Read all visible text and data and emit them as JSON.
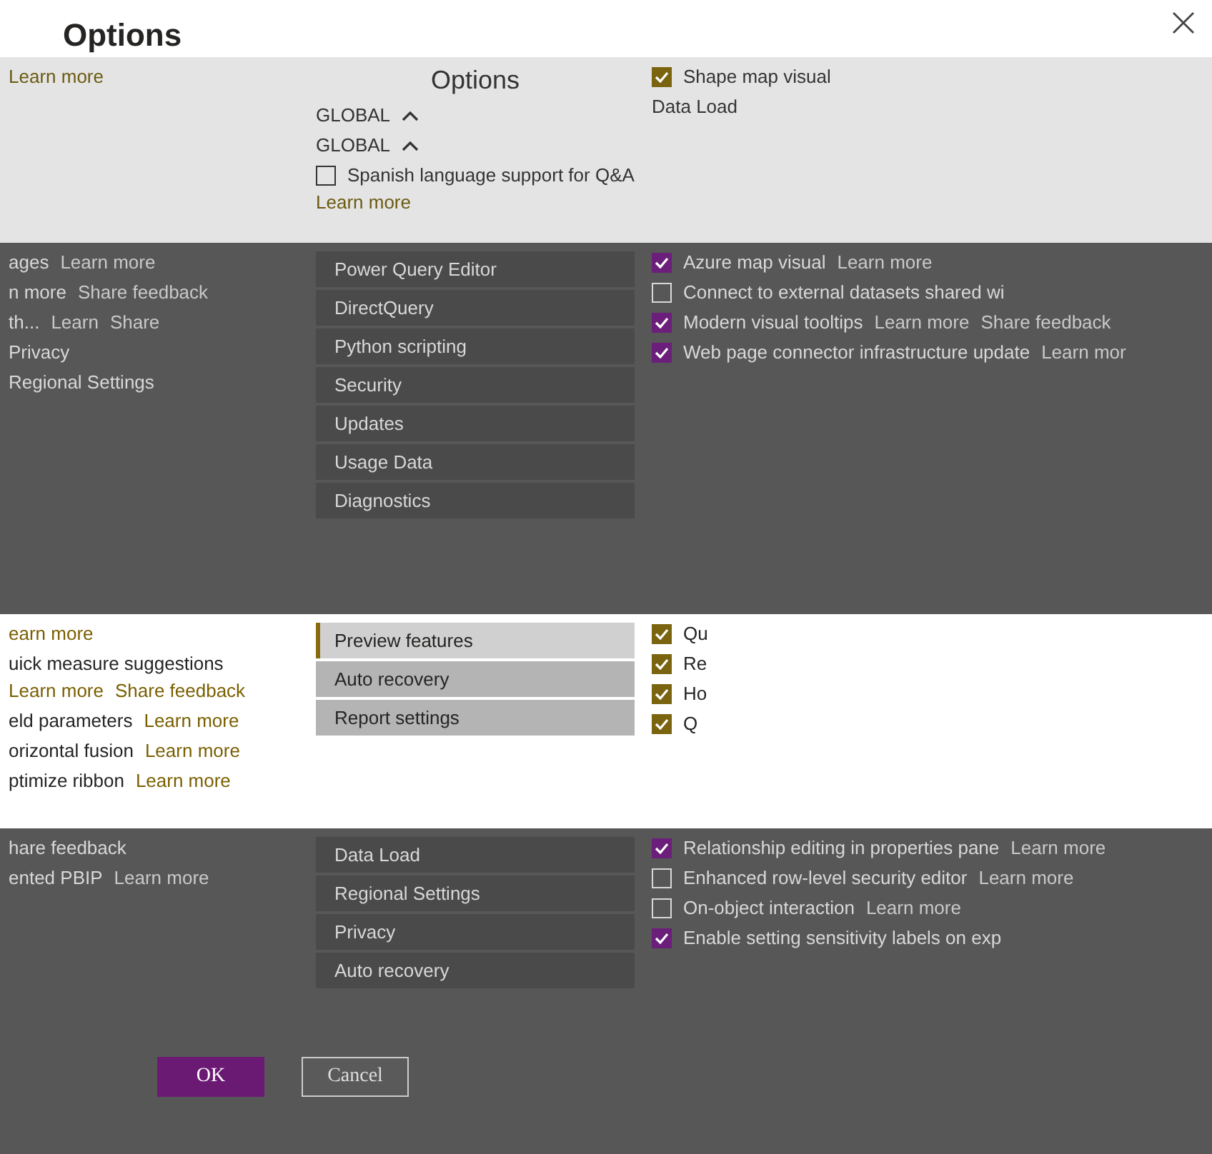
{
  "window": {
    "title": "Options"
  },
  "bands": [
    {
      "kind": "light",
      "columns": [
        [
          {
            "kind": "link",
            "text": "Learn more"
          }
        ],
        [
          {
            "kind": "heading",
            "text": "Options"
          },
          {
            "kind": "scope",
            "text": "GLOBAL"
          },
          {
            "kind": "scope",
            "text": "GLOBAL"
          },
          {
            "kind": "check",
            "label": "Spanish language support for Q&A",
            "checked": false,
            "links": [
              "Learn more"
            ]
          }
        ],
        [
          {
            "kind": "check",
            "label": "Shape map visual",
            "checked": true
          },
          {
            "kind": "line",
            "text": "Data Load"
          }
        ]
      ]
    },
    {
      "kind": "dark",
      "columns": [
        [
          {
            "kind": "line",
            "text": "ages",
            "links": [
              "Learn more"
            ]
          },
          {
            "kind": "line",
            "text": "n more",
            "links": [
              "Share feedback"
            ]
          },
          {
            "kind": "line",
            "text": "th...",
            "links": [
              "Learn",
              "Share"
            ]
          },
          {
            "kind": "line",
            "text": "Privacy"
          },
          {
            "kind": "line",
            "text": "Regional Settings"
          }
        ],
        [
          {
            "kind": "nav",
            "label": "Power Query Editor",
            "selected": false
          },
          {
            "kind": "nav",
            "label": "DirectQuery",
            "selected": false
          },
          {
            "kind": "nav",
            "label": "Python scripting",
            "selected": false
          },
          {
            "kind": "nav",
            "label": "Security",
            "selected": false
          },
          {
            "kind": "nav",
            "label": "Updates",
            "selected": false
          },
          {
            "kind": "nav",
            "label": "Usage Data",
            "selected": false
          },
          {
            "kind": "nav",
            "label": "Diagnostics",
            "selected": false
          }
        ],
        [
          {
            "kind": "check",
            "label": "Azure map visual",
            "checked": true,
            "links": [
              "Learn more"
            ]
          },
          {
            "kind": "check",
            "label": "Connect to external datasets shared wi",
            "checked": false
          },
          {
            "kind": "check",
            "label": "Modern visual tooltips",
            "checked": true,
            "links": [
              "Learn more",
              "Share feedback"
            ]
          },
          {
            "kind": "check",
            "label": "Web page connector infrastructure update",
            "checked": true,
            "links": [
              "Learn mor"
            ]
          }
        ]
      ]
    },
    {
      "kind": "white",
      "columns": [
        [
          {
            "kind": "link",
            "text": "earn more"
          },
          {
            "kind": "line",
            "text": "uick measure suggestions",
            "links": [
              "Learn more",
              "Share feedback"
            ]
          },
          {
            "kind": "line",
            "text": "eld parameters",
            "links": [
              "Learn more"
            ]
          },
          {
            "kind": "line",
            "text": "orizontal fusion",
            "links": [
              "Learn more"
            ]
          },
          {
            "kind": "line",
            "text": "ptimize ribbon",
            "links": [
              "Learn more"
            ]
          }
        ],
        [
          {
            "kind": "nav",
            "label": "Preview features",
            "selected": true
          },
          {
            "kind": "nav",
            "label": "Auto recovery",
            "selected": false
          },
          {
            "kind": "nav",
            "label": "Report settings",
            "selected": false
          }
        ],
        [
          {
            "kind": "check",
            "label": "Qu",
            "checked": true
          },
          {
            "kind": "check",
            "label": "Re",
            "checked": true
          },
          {
            "kind": "check",
            "label": "Ho",
            "checked": true
          },
          {
            "kind": "check",
            "label": "Q",
            "checked": true
          }
        ]
      ]
    },
    {
      "kind": "dark",
      "columns": [
        [
          {
            "kind": "line",
            "text": "hare feedback"
          },
          {
            "kind": "line",
            "text": "ented PBIP",
            "links": [
              "Learn more"
            ]
          }
        ],
        [
          {
            "kind": "nav",
            "label": "Data Load",
            "selected": false
          },
          {
            "kind": "nav",
            "label": "Regional Settings",
            "selected": false
          },
          {
            "kind": "nav",
            "label": "Privacy",
            "selected": false
          },
          {
            "kind": "nav",
            "label": "Auto recovery",
            "selected": false
          }
        ],
        [
          {
            "kind": "check",
            "label": "Relationship editing in properties pane",
            "checked": true,
            "links": [
              "Learn more"
            ]
          },
          {
            "kind": "check",
            "label": "Enhanced row-level security editor",
            "checked": false,
            "links": [
              "Learn more"
            ]
          },
          {
            "kind": "check",
            "label": "On-object interaction",
            "checked": false,
            "links": [
              "Learn more"
            ]
          },
          {
            "kind": "check",
            "label": "Enable setting sensitivity labels on exp",
            "checked": true
          }
        ]
      ]
    }
  ],
  "buttons": [
    {
      "label": "OK",
      "kind": "primary"
    },
    {
      "label": "Cancel",
      "kind": "secondary"
    }
  ]
}
